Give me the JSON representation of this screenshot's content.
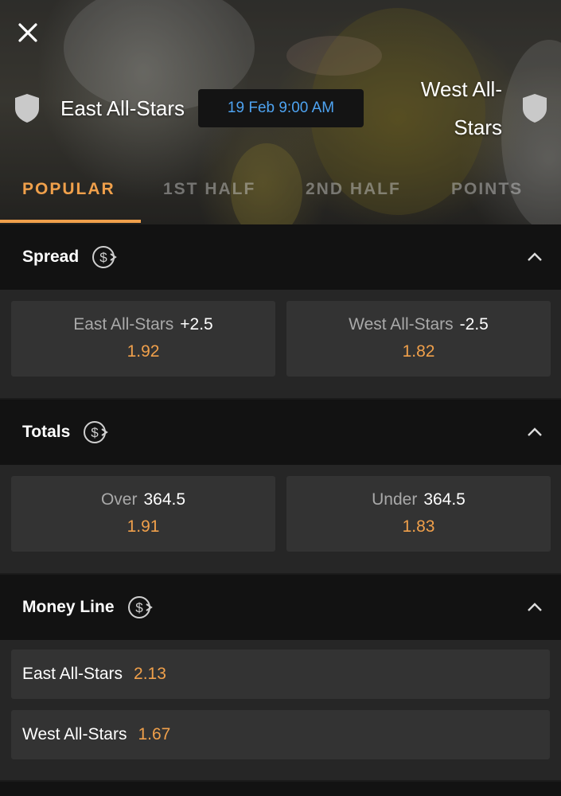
{
  "header": {
    "close_icon": "close-icon",
    "home_team": "East All-Stars",
    "away_team": "West All-Stars",
    "event_time": "19 Feb 9:00 AM"
  },
  "tabs": [
    {
      "label": "POPULAR",
      "active": true
    },
    {
      "label": "1ST HALF",
      "active": false
    },
    {
      "label": "2ND HALF",
      "active": false
    },
    {
      "label": "POINTS",
      "active": false
    }
  ],
  "markets": {
    "spread": {
      "title": "Spread",
      "selections": [
        {
          "team": "East All-Stars",
          "line": "+2.5",
          "odds": "1.92"
        },
        {
          "team": "West All-Stars",
          "line": "-2.5",
          "odds": "1.82"
        }
      ]
    },
    "totals": {
      "title": "Totals",
      "selections": [
        {
          "label": "Over",
          "line": "364.5",
          "odds": "1.91"
        },
        {
          "label": "Under",
          "line": "364.5",
          "odds": "1.83"
        }
      ]
    },
    "money_line": {
      "title": "Money Line",
      "selections": [
        {
          "team": "East All-Stars",
          "odds": "2.13"
        },
        {
          "team": "West All-Stars",
          "odds": "1.67"
        }
      ]
    }
  },
  "colors": {
    "accent": "#f0a04b",
    "date_text": "#4ea3f1",
    "section_header": "#121212",
    "cell_bg": "#333333"
  }
}
